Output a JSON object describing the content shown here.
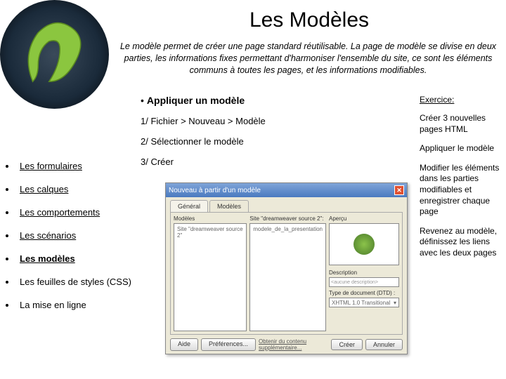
{
  "title": "Les Modèles",
  "intro": "Le modèle permet de créer une page standard réutilisable. La page de modèle se divise en deux parties, les informations fixes permettant d'harmoniser l'ensemble du site, ce sont les éléments communs à toutes les pages, et les informations modifiables.",
  "subheading": "Appliquer un modèle",
  "steps": {
    "s1": "1/ Fichier > Nouveau > Modèle",
    "s2": "2/ Sélectionner le modèle",
    "s3": "3/ Créer"
  },
  "exercise": {
    "title": "Exercice:",
    "e1": "Créer 3 nouvelles pages HTML",
    "e2": "Appliquer le modèle",
    "e3": "Modifier les éléments dans les parties modifiables et enregistrer chaque page",
    "e4": "Revenez au modèle, définissez les liens avec les deux pages"
  },
  "sidebar": {
    "items": [
      {
        "label": "Les formulaires"
      },
      {
        "label": "Les calques"
      },
      {
        "label": "Les comportements"
      },
      {
        "label": "Les scénarios"
      },
      {
        "label": "Les modèles"
      },
      {
        "label": "Les feuilles de styles (CSS)"
      },
      {
        "label": "La mise en ligne"
      }
    ]
  },
  "dialog": {
    "title": "Nouveau à partir d'un modèle",
    "tabs": {
      "general": "Général",
      "models": "Modèles"
    },
    "col1_label": "Modèles",
    "col1_item": "Site \"dreamweaver source 2\"",
    "col2_label": "Site \"dreamweaver source 2\":",
    "col2_item": "modele_de_la_presentation",
    "preview_label": "Aperçu",
    "desc_label": "Description",
    "desc_value": "<aucune description>",
    "dtd_label": "Type de document (DTD) :",
    "dtd_value": "XHTML 1.0 Transitional",
    "help": "Aide",
    "prefs": "Préférences...",
    "extra": "Obtenir du contenu supplémentaire...",
    "create": "Créer",
    "cancel": "Annuler"
  }
}
